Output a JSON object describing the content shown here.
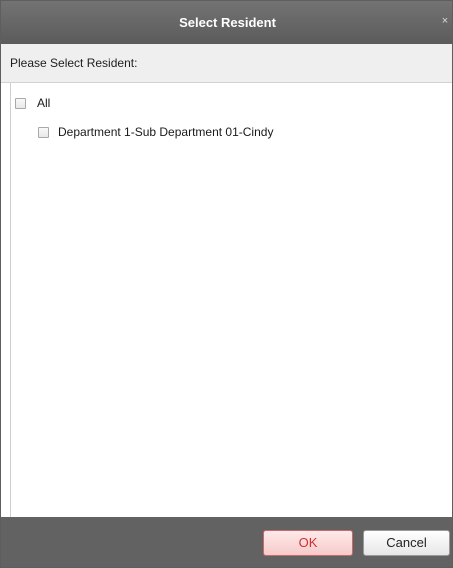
{
  "dialog": {
    "title": "Select Resident",
    "close_glyph": "×"
  },
  "prompt": "Please Select Resident:",
  "list": {
    "all_label": "All",
    "items": [
      {
        "label": "Department 1-Sub Department 01-Cindy",
        "checked": false
      }
    ],
    "all_checked": false
  },
  "footer": {
    "ok_label": "OK",
    "cancel_label": "Cancel"
  },
  "colors": {
    "titlebar": "#666666",
    "footer": "#626262",
    "ok_text": "#d03030",
    "subheader": "#efefef"
  },
  "icons": {
    "close": "close-icon",
    "checkbox": "checkbox-icon"
  }
}
